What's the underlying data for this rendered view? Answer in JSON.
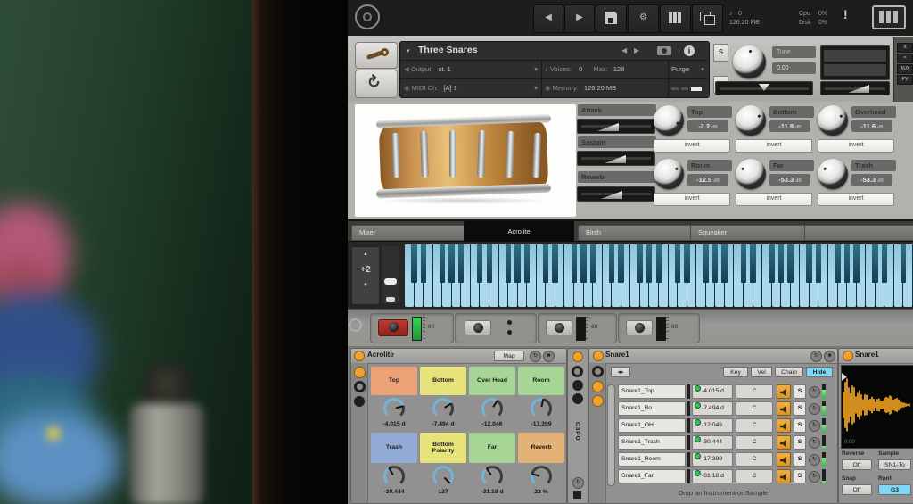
{
  "kontakt": {
    "topbar": {
      "voices": "0",
      "memory": "126.20 MB",
      "cpu_label": "Cpu",
      "cpu_value": "0%",
      "disk_label": "Disk",
      "disk_value": "0%",
      "alert": "!"
    },
    "header": {
      "title": "Three Snares",
      "output_label": "Output:",
      "output_value": "st. 1",
      "midi_label": "MIDI Ch:",
      "midi_value": "[A] 1",
      "voices_label": "Voices:",
      "voices_value": "0",
      "max_label": "Max:",
      "max_value": "128",
      "memory_label": "Memory:",
      "memory_value": "126.20 MB",
      "purge_label": "Purge",
      "solo_label": "S",
      "mute_label": "M",
      "tune_label": "Tune",
      "tune_value": "0.00",
      "close_label": "X",
      "min_label": "=",
      "aux_label": "AUX",
      "pv_label": "PV"
    },
    "performance": {
      "sliders": [
        {
          "label": "Attack"
        },
        {
          "label": "Sustain"
        },
        {
          "label": "Reverb"
        }
      ],
      "knobs": [
        {
          "label": "Top",
          "value": "-2.2",
          "unit": "dB",
          "invert_label": "invert"
        },
        {
          "label": "Bottom",
          "value": "-11.8",
          "unit": "dB",
          "invert_label": "invert"
        },
        {
          "label": "Overhead",
          "value": "-11.6",
          "unit": "dB",
          "invert_label": "invert"
        },
        {
          "label": "Room",
          "value": "-12.5",
          "unit": "dB",
          "invert_label": "invert"
        },
        {
          "label": "Far",
          "value": "-53.3",
          "unit": "dB",
          "invert_label": "invert"
        },
        {
          "label": "Trash",
          "value": "-53.3",
          "unit": "dB",
          "invert_label": "invert"
        }
      ]
    },
    "tabs": [
      {
        "label": "Mixer"
      },
      {
        "label": "Acrolite"
      },
      {
        "label": "Birch"
      },
      {
        "label": "Squeaker"
      }
    ],
    "keyboard": {
      "octave_shift": "+2"
    }
  },
  "live": {
    "mixer_strip": {
      "meter_scale": "60"
    },
    "acrolite": {
      "title": "Acrolite",
      "map_label": "Map",
      "macros": [
        {
          "label": "Top",
          "value": "-4.015 d",
          "color": "#eda176"
        },
        {
          "label": "Bottom",
          "value": "-7.494 d",
          "color": "#e6e37b"
        },
        {
          "label": "Over Head",
          "value": "-12.046",
          "color": "#a6d596"
        },
        {
          "label": "Room",
          "value": "-17.399",
          "color": "#a6d596"
        },
        {
          "label": "Trash",
          "value": "-30.444",
          "color": "#92abd6"
        },
        {
          "label": "Bottom Polarity",
          "value": "127",
          "color": "#e6e37b"
        },
        {
          "label": "Far",
          "value": "-31.18 d",
          "color": "#a6d596"
        },
        {
          "label": "Reverb",
          "value": "22 %",
          "color": "#e2b277"
        }
      ]
    },
    "folded_device": {
      "title": "C3PO"
    },
    "rack": {
      "title": "Snare1",
      "key_label": "Key",
      "vel_label": "Vel",
      "chain_label": "Chain",
      "hide_label": "Hide",
      "solo_label": "S",
      "chains": [
        {
          "name": "Snare1_Top",
          "volume": "-4.015 d",
          "pan": "C"
        },
        {
          "name": "Snare1_Bo...",
          "volume": "-7.494 d",
          "pan": "C"
        },
        {
          "name": "Snare1_OH",
          "volume": "-12.046",
          "pan": "C"
        },
        {
          "name": "Snare1_Trash",
          "volume": "-30.444",
          "pan": "C"
        },
        {
          "name": "Snare1_Room",
          "volume": "-17.399",
          "pan": "C"
        },
        {
          "name": "Snare1_Far",
          "volume": "-31.18 d",
          "pan": "C"
        }
      ],
      "drop_hint": "Drop an Instrument or Sample"
    },
    "simpler": {
      "title": "Snare1",
      "time_label": "0:00",
      "reverse_label": "Reverse",
      "reverse_value": "Off",
      "sample_label": "Sample",
      "sample_value": "SN1-To",
      "snap_label": "Snap",
      "snap_value": "Off",
      "root_label": "Root",
      "root_value": "G3"
    },
    "colors": {
      "accent_orange": "#f0a22e",
      "hide_active": "#82d6f2",
      "root_active": "#82d6f2",
      "waveform": "#f5a623"
    }
  }
}
